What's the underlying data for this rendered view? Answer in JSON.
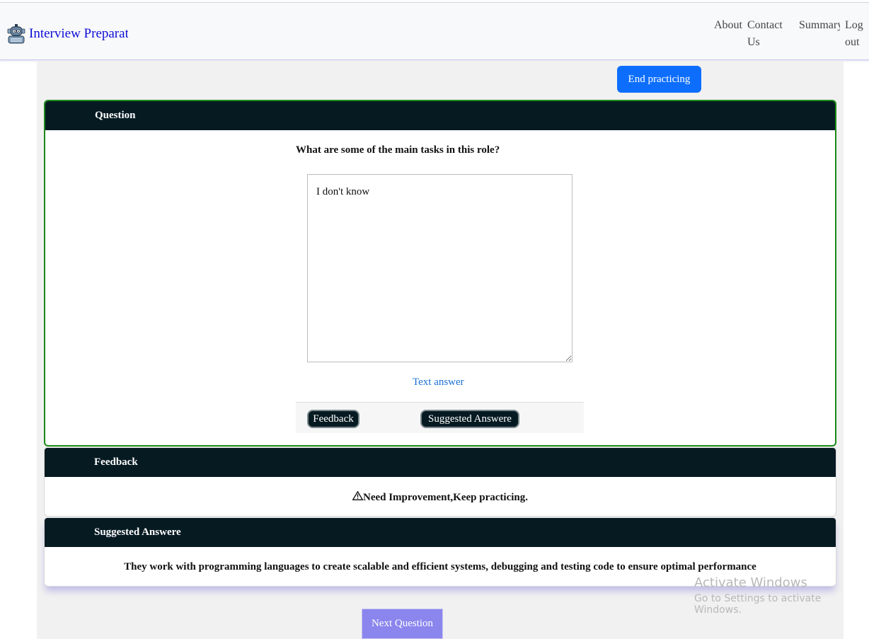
{
  "nav": {
    "brand": "Interview Preparation",
    "about": "About",
    "contact": "Contact Us",
    "summary": "Summary",
    "logout": "Log out"
  },
  "end_button": "End practicing",
  "question_card": {
    "header": "Question",
    "question": "What are some of the main tasks in this role?",
    "answer": "I don't know",
    "text_answer_link": "Text answer",
    "feedback_button": "Feedback",
    "suggested_button": "Suggested Answere"
  },
  "feedback_card": {
    "header": "Feedback",
    "message": "Need Improvement,Keep practicing."
  },
  "suggested_card": {
    "header": "Suggested Answere",
    "answer": "They work with programming languages to create scalable and efficient systems, debugging and testing code to ensure optimal performance"
  },
  "next_button": "Next Question",
  "watermark": {
    "title": "Activate Windows",
    "subtitle": "Go to Settings to activate Windows."
  },
  "colors": {
    "primary": "#0d6efd",
    "header_dark": "#061a22",
    "question_border": "#1a8a1a",
    "next_button": "#8b85ee",
    "brand_text": "#0d0dd8"
  }
}
